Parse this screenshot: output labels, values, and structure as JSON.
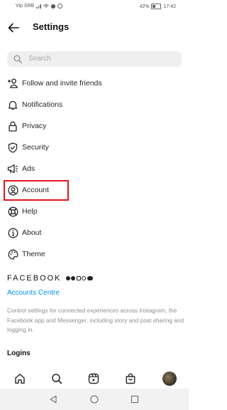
{
  "status_bar": {
    "carrier": "Vip SRB",
    "battery": "42%",
    "time": "17:42"
  },
  "header": {
    "title": "Settings",
    "back_icon": "arrow-left-icon"
  },
  "search": {
    "placeholder": "Search",
    "icon": "search-icon"
  },
  "menu": {
    "items": [
      {
        "label": "Follow and invite friends",
        "icon": "add-person-icon"
      },
      {
        "label": "Notifications",
        "icon": "bell-icon"
      },
      {
        "label": "Privacy",
        "icon": "lock-icon"
      },
      {
        "label": "Security",
        "icon": "shield-check-icon"
      },
      {
        "label": "Ads",
        "icon": "megaphone-icon"
      },
      {
        "label": "Account",
        "icon": "user-circle-icon",
        "highlighted": true
      },
      {
        "label": "Help",
        "icon": "lifebuoy-icon"
      },
      {
        "label": "About",
        "icon": "info-icon"
      },
      {
        "label": "Theme",
        "icon": "palette-icon"
      }
    ]
  },
  "facebook_section": {
    "heading": "FACEBOOK",
    "accounts_centre": "Accounts Centre",
    "description": "Control settings for connected experiences across Instagram, the Facebook app and Messenger, including story and post sharing and logging in."
  },
  "logins": {
    "heading": "Logins"
  },
  "bottom_tabs": [
    "home-icon",
    "search-icon",
    "reels-icon",
    "shop-icon",
    "profile-avatar"
  ],
  "colors": {
    "highlight": "#e0161f",
    "link": "#0095f6",
    "text": "#262626",
    "muted": "#8e8e8e"
  }
}
